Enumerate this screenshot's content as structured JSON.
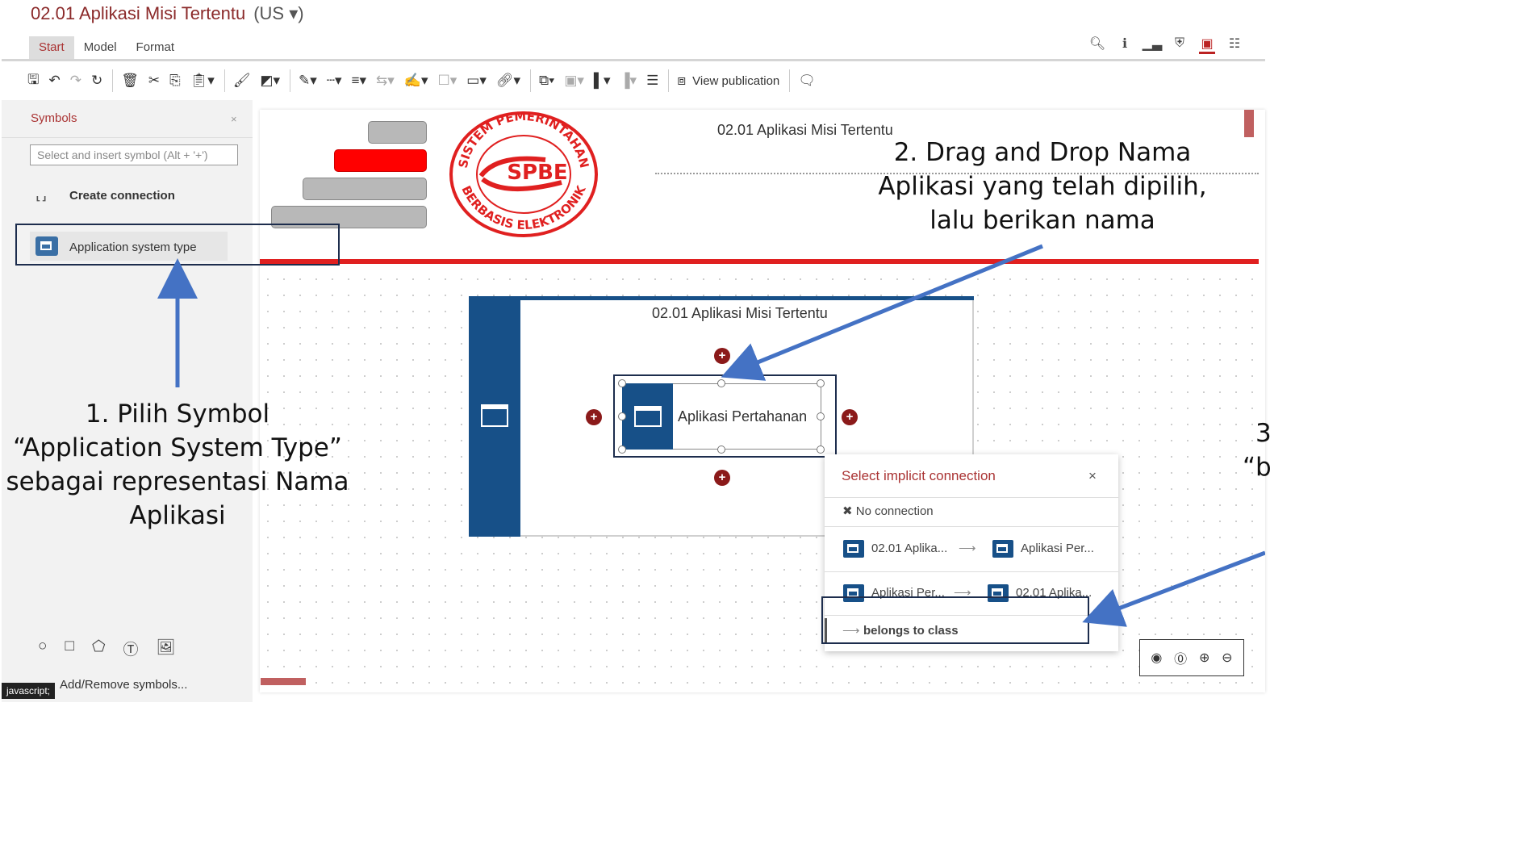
{
  "window": {
    "title": "02.01 Aplikasi Misi Tertentu",
    "language": "(US ▾)"
  },
  "menu_tabs": [
    {
      "label": "Start"
    },
    {
      "label": "Model"
    },
    {
      "label": "Format"
    }
  ],
  "toolbar": {
    "view_publication": "View publication"
  },
  "symbols_panel": {
    "title": "Symbols",
    "close": "×",
    "search_placeholder": "Select and insert symbol (Alt + '+')",
    "create_connection": "Create connection",
    "items": [
      {
        "label": "Application system type",
        "icon": "application-window-icon"
      }
    ],
    "add_remove": "Add/Remove symbols..."
  },
  "status_bar": {
    "text": "javascript;"
  },
  "document": {
    "title": "02.01 Aplikasi Misi Tertentu"
  },
  "diagram": {
    "lane_title": "02.01 Aplikasi Misi Tertentu",
    "node_label": "Aplikasi Pertahanan"
  },
  "implicit_connection_popup": {
    "title": "Select implicit connection",
    "close": "×",
    "no_connection": "No connection",
    "options": [
      {
        "from": "02.01 Aplika...",
        "to": "Aplikasi Per..."
      },
      {
        "from": "Aplikasi Per...",
        "to": "02.01 Aplika..."
      }
    ],
    "belongs_label": "belongs to class"
  },
  "annotations": {
    "step1": [
      "1. Pilih Symbol",
      "“Application System Type”",
      "sebagai representasi Nama",
      "Aplikasi"
    ],
    "step2": [
      "2. Drag and Drop Nama",
      "Aplikasi yang telah dipilih,",
      "lalu berikan nama"
    ],
    "step3": [
      "3",
      "“b"
    ]
  },
  "logo": {
    "top_text": "SISTEM PEMERINTAHAN",
    "bottom_text": "BERBASIS ELEKTRONIK",
    "center_text": "SPBE"
  },
  "colors": {
    "accent": "#a33333",
    "lane_blue": "#175088",
    "highlight_red": "#e02020",
    "arrow_blue": "#4472c4"
  }
}
